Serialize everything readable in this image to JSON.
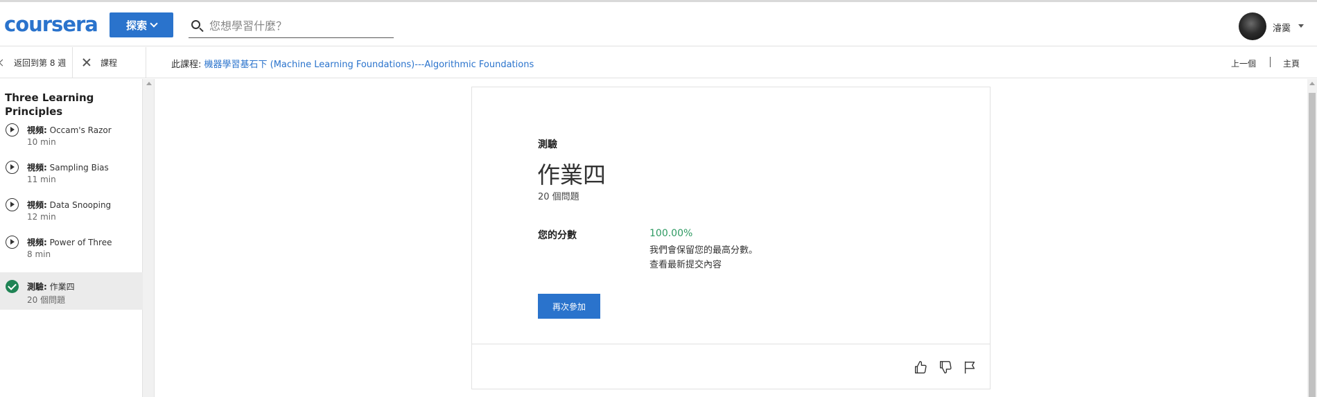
{
  "header": {
    "logo": "coursera",
    "explore_label": "探索",
    "search_placeholder": "您想學習什麼？",
    "user_name": "濬霙"
  },
  "subbar": {
    "back_label": "返回到第 8 週",
    "course_label": "課程",
    "course_prefix": "此課程: ",
    "course_name": "機器學習基石下 (Machine Learning Foundations)---Algorithmic Foundations",
    "prev_label": "上一個",
    "home_label": "主頁"
  },
  "sidebar": {
    "title": "Three Learning Principles",
    "items": [
      {
        "kind": "視頻:",
        "name": " Occam's Razor",
        "meta": "10 min",
        "icon": "play-icon",
        "active": false
      },
      {
        "kind": "視頻:",
        "name": " Sampling Bias",
        "meta": "11 min",
        "icon": "play-icon",
        "active": false
      },
      {
        "kind": "視頻:",
        "name": " Data Snooping",
        "meta": "12 min",
        "icon": "play-icon",
        "active": false
      },
      {
        "kind": "視頻:",
        "name": " Power of Three",
        "meta": "8 min",
        "icon": "play-icon",
        "active": false
      },
      {
        "kind": "測驗:",
        "name": " 作業四",
        "meta": "20 個問題",
        "icon": "check-icon",
        "active": true
      }
    ]
  },
  "quiz": {
    "kind": "測驗",
    "title": "作業四",
    "question_count": "20 個問題",
    "score_label": "您的分數",
    "score_value": "100.00%",
    "score_note": "我們會保留您的最高分數。",
    "view_latest": "查看最新提交內容",
    "retake_label": "再次參加"
  },
  "colors": {
    "brand": "#2a73cc",
    "success": "#2e9a62",
    "check": "#1f8354"
  }
}
